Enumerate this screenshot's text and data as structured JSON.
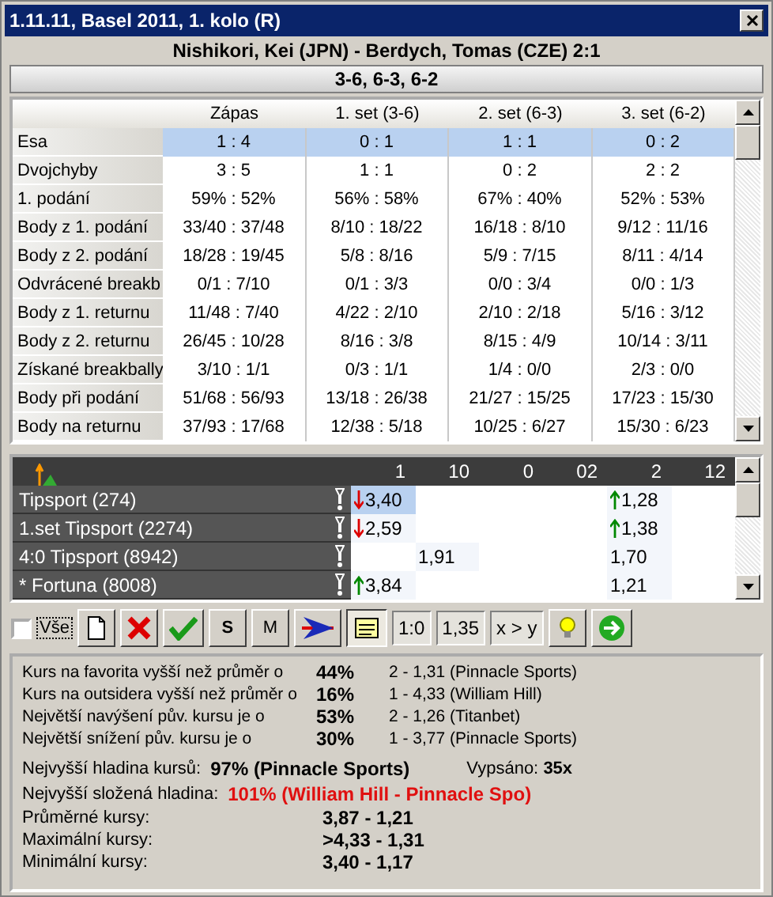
{
  "window": {
    "title": "1.11.11, Basel 2011, 1. kolo (R)"
  },
  "match": "Nishikori, Kei (JPN) - Berdych, Tomas (CZE) 2:1",
  "score": "3-6, 6-3, 6-2",
  "stats": {
    "columns": [
      "Zápas",
      "1. set  (3-6)",
      "2. set  (6-3)",
      "3. set  (6-2)"
    ],
    "rows": [
      {
        "label": "Esa",
        "selected": true,
        "values": [
          "1 : 4",
          "0 : 1",
          "1 : 1",
          "0 : 2"
        ]
      },
      {
        "label": "Dvojchyby",
        "selected": false,
        "values": [
          "3 : 5",
          "1 : 1",
          "0 : 2",
          "2 : 2"
        ]
      },
      {
        "label": "1. podání",
        "selected": false,
        "values": [
          "59% : 52%",
          "56% : 58%",
          "67% : 40%",
          "52% : 53%"
        ]
      },
      {
        "label": "Body z 1. podání",
        "selected": false,
        "values": [
          "33/40 : 37/48",
          "8/10 : 18/22",
          "16/18 : 8/10",
          "9/12 : 11/16"
        ]
      },
      {
        "label": "Body z 2. podání",
        "selected": false,
        "values": [
          "18/28 : 19/45",
          "5/8 : 8/16",
          "5/9 : 7/15",
          "8/11 : 4/14"
        ]
      },
      {
        "label": "Odvrácené breakb",
        "selected": false,
        "values": [
          "0/1 : 7/10",
          "0/1 : 3/3",
          "0/0 : 3/4",
          "0/0 : 1/3"
        ]
      },
      {
        "label": "Body z 1. returnu",
        "selected": false,
        "values": [
          "11/48 : 7/40",
          "4/22 : 2/10",
          "2/10 : 2/18",
          "5/16 : 3/12"
        ]
      },
      {
        "label": "Body z 2. returnu",
        "selected": false,
        "values": [
          "26/45 : 10/28",
          "8/16 : 3/8",
          "8/15 : 4/9",
          "10/14 : 3/11"
        ]
      },
      {
        "label": "Získané breakbally",
        "selected": false,
        "values": [
          "3/10 : 1/1",
          "0/3 : 1/1",
          "1/4 : 0/0",
          "2/3 : 0/0"
        ]
      },
      {
        "label": "Body při podání",
        "selected": false,
        "values": [
          "51/68 : 56/93",
          "13/18 : 26/38",
          "21/27 : 15/25",
          "17/23 : 15/30"
        ]
      },
      {
        "label": "Body na returnu",
        "selected": false,
        "values": [
          "37/93 : 17/68",
          "12/38 : 5/18",
          "10/25 : 6/27",
          "15/30 : 6/23"
        ]
      }
    ]
  },
  "odds": {
    "columns": [
      "1",
      "10",
      "0",
      "02",
      "2",
      "12"
    ],
    "rows": [
      {
        "name": "Tipsport (274)",
        "cells": [
          {
            "value": "3,40",
            "up": false,
            "down": true,
            "selected": true
          },
          null,
          null,
          null,
          {
            "value": "1,28",
            "up": true,
            "down": false,
            "selected": false
          },
          null
        ]
      },
      {
        "name": "1.set Tipsport (2274)",
        "cells": [
          {
            "value": "2,59",
            "up": false,
            "down": true,
            "selected": false
          },
          null,
          null,
          null,
          {
            "value": "1,38",
            "up": true,
            "down": false,
            "selected": false
          },
          null
        ]
      },
      {
        "name": "4:0 Tipsport (8942)",
        "cells": [
          null,
          {
            "value": "1,91",
            "up": false,
            "down": false,
            "selected": false
          },
          null,
          null,
          {
            "value": "1,70",
            "up": false,
            "down": false,
            "selected": false
          },
          null
        ]
      },
      {
        "name": "* Fortuna (8008)",
        "cells": [
          {
            "value": "3,84",
            "up": true,
            "down": false,
            "selected": false
          },
          null,
          null,
          null,
          {
            "value": "1,21",
            "up": false,
            "down": false,
            "selected": false
          },
          null
        ]
      }
    ]
  },
  "toolbar": {
    "all_checkbox": {
      "label": "Vše",
      "checked": false
    },
    "s_button": "S",
    "m_button": "M",
    "fields": [
      "1:0",
      "1,35",
      "x > y"
    ]
  },
  "summary": [
    {
      "label": "Kurs na favorita vyšší než průměr o",
      "value": "44%",
      "detail": "2 - 1,31 (Pinnacle Sports)"
    },
    {
      "label": "Kurs na outsidera vyšší než průměr o",
      "value": "16%",
      "detail": "1 - 4,33 (William Hill)"
    },
    {
      "label": "Největší navýšení pův. kursu je o",
      "value": "53%",
      "detail": "2 - 1,26 (Titanbet)"
    },
    {
      "label": "Největší snížení pův. kursu je o",
      "value": "30%",
      "detail": "1 - 3,77 (Pinnacle Sports)"
    }
  ],
  "levels": [
    {
      "label": "Nejvyšší hladina kursů:",
      "value": "97%  (Pinnacle Sports)",
      "alert": false,
      "extra_label": "Vypsáno:",
      "extra_value": "35x"
    },
    {
      "label": "Nejvyšší složená hladina:",
      "value": "101%  (William Hill - Pinnacle Spo)",
      "alert": true
    }
  ],
  "averages": [
    {
      "label": "Průměrné kursy:",
      "value": "3,87 - 1,21"
    },
    {
      "label": "Maximální kursy:",
      "value": ">4,33 - 1,31"
    },
    {
      "label": "Minimální kursy:",
      "value": "3,40 - 1,17"
    }
  ]
}
